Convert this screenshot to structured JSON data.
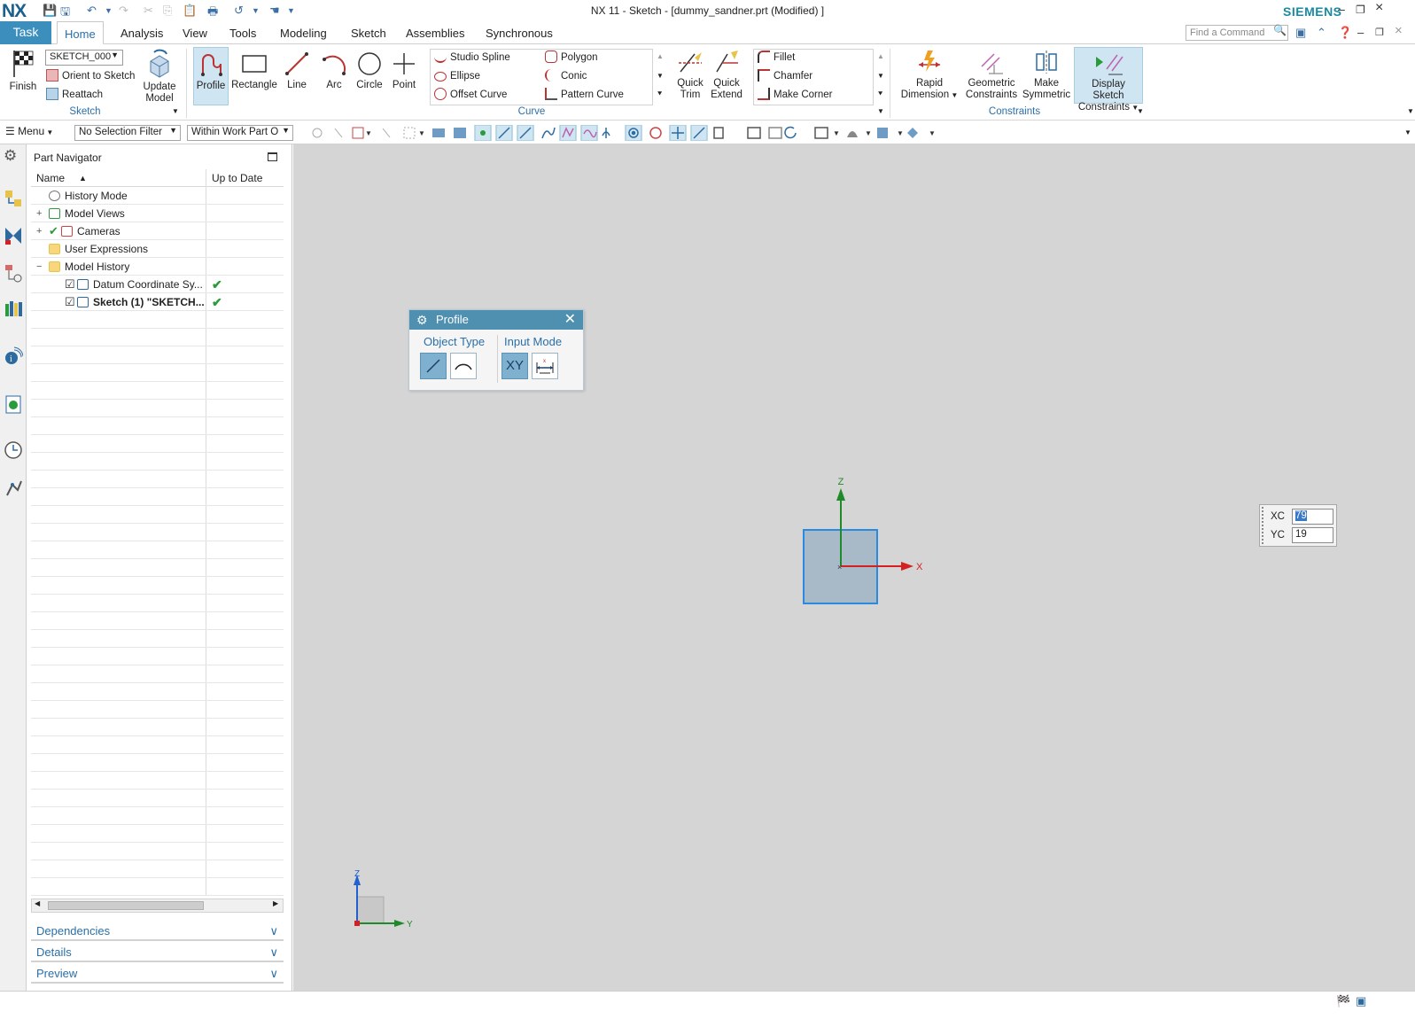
{
  "app": {
    "logo": "NX",
    "window_title": "NX 11 - Sketch - [dummy_sandner.prt (Modified) ]",
    "brand": "SIEMENS"
  },
  "tabs": {
    "task": "Task",
    "items": [
      "Home",
      "Analysis",
      "View",
      "Tools",
      "Modeling",
      "Sketch",
      "Assemblies",
      "Synchronous"
    ],
    "active": "Home"
  },
  "search": {
    "placeholder": "Find a Command"
  },
  "ribbon": {
    "sketch_group": {
      "label": "Sketch",
      "finish": "Finish",
      "sketch_name": "SKETCH_000",
      "orient": "Orient to Sketch",
      "reattach": "Reattach",
      "update_model_1": "Update",
      "update_model_2": "Model"
    },
    "curve_group": {
      "label": "Curve",
      "profile": "Profile",
      "rectangle": "Rectangle",
      "line": "Line",
      "arc": "Arc",
      "circle": "Circle",
      "point": "Point",
      "studio_spline": "Studio Spline",
      "polygon": "Polygon",
      "ellipse": "Ellipse",
      "conic": "Conic",
      "offset_curve": "Offset Curve",
      "pattern_curve": "Pattern Curve",
      "quick_trim_1": "Quick",
      "quick_trim_2": "Trim",
      "quick_extend_1": "Quick",
      "quick_extend_2": "Extend",
      "fillet": "Fillet",
      "chamfer": "Chamfer",
      "make_corner": "Make Corner"
    },
    "constraints_group": {
      "label": "Constraints",
      "rapid_dimension_1": "Rapid",
      "rapid_dimension_2": "Dimension",
      "geometric_1": "Geometric",
      "geometric_2": "Constraints",
      "make_symmetric_1": "Make",
      "make_symmetric_2": "Symmetric",
      "display_sketch_1": "Display Sketch",
      "display_sketch_2": "Constraints"
    }
  },
  "toolbar": {
    "menu": "Menu",
    "selection_filter": "No Selection Filter",
    "scope": "Within Work Part O"
  },
  "navigator": {
    "title": "Part Navigator",
    "columns": [
      "Name",
      "Up to Date"
    ],
    "rows": [
      {
        "label": "History Mode",
        "expand": "",
        "check": "",
        "uptodate": ""
      },
      {
        "label": "Model Views",
        "expand": "+",
        "check": "",
        "uptodate": ""
      },
      {
        "label": "Cameras",
        "expand": "+",
        "check": "✔",
        "uptodate": ""
      },
      {
        "label": "User Expressions",
        "expand": "",
        "check": "",
        "uptodate": ""
      },
      {
        "label": "Model History",
        "expand": "−",
        "check": "",
        "uptodate": ""
      },
      {
        "label": "Datum Coordinate Sy...",
        "expand": "",
        "check": "☑",
        "uptodate": "✔"
      },
      {
        "label": "Sketch (1) \"SKETCH...",
        "expand": "",
        "check": "☑",
        "uptodate": "✔"
      }
    ],
    "sections": [
      "Dependencies",
      "Details",
      "Preview"
    ]
  },
  "profile_dialog": {
    "title": "Profile",
    "object_type": "Object Type",
    "input_mode": "Input Mode",
    "xy_label": "XY"
  },
  "coord_input": {
    "xc_label": "XC",
    "xc_value": "79",
    "yc_label": "YC",
    "yc_value": "19"
  },
  "axes": {
    "sketch_x": "X",
    "sketch_z": "Z",
    "triad_z": "Z",
    "triad_y": "Y"
  },
  "colors": {
    "accent": "#3c8fbd",
    "label_blue": "#2a6fa8",
    "viewport": "#d5d5d5",
    "axis_x": "#d42020",
    "axis_y": "#1f8a2a",
    "axis_z": "#2060d0"
  }
}
